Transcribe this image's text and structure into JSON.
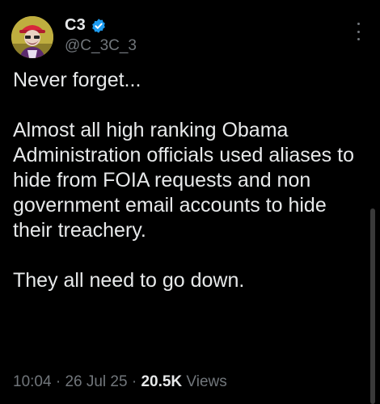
{
  "post": {
    "author": {
      "display_name": "C3",
      "handle": "@C_3C_3",
      "verified": true,
      "avatar_icon": "cartoon-avatar"
    },
    "text": {
      "paragraph_1": "Never forget...",
      "paragraph_2": "Almost all high ranking Obama Administration officials used aliases to hide from FOIA requests and non government email accounts to hide their treachery.",
      "paragraph_3": "They all need to go down."
    },
    "meta": {
      "time": "10:04",
      "separator_1": " · ",
      "date": "26 Jul 25",
      "separator_2": " · ",
      "views_count": "20.5K",
      "views_label": " Views"
    },
    "more_icon": "more-vertical-icon"
  },
  "colors": {
    "background": "#000000",
    "primary_text": "#e7e9ea",
    "secondary_text": "#71767b",
    "verified_badge": "#1d9bf0"
  }
}
